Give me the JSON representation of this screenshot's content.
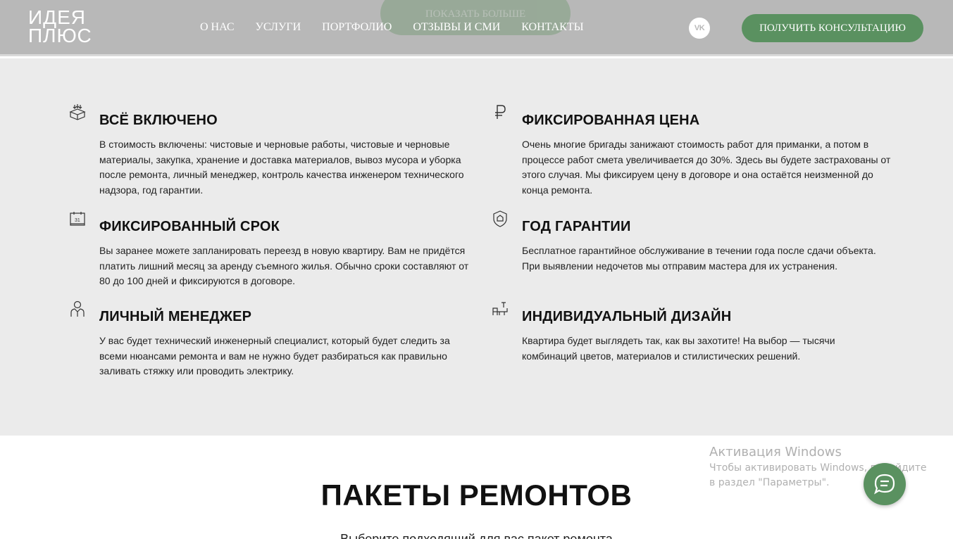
{
  "header": {
    "logo_line1": "ИДЕЯ",
    "logo_line2": "ПЛЮС",
    "ghost_button": "ПОКАЗАТЬ БОЛЬШЕ",
    "nav": [
      "О НАС",
      "УСЛУГИ",
      "ПОРТФОЛИО",
      "ОТЗЫВЫ И СМИ",
      "КОНТАКТЫ"
    ],
    "vk_label": "VK",
    "cta_label": "ПОЛУЧИТЬ КОНСУЛЬТАЦИЮ"
  },
  "features": [
    {
      "icon": "box-icon",
      "title": "ВСЁ ВКЛЮЧЕНО",
      "text": "В стоимость включены: чистовые и черновые работы, чистовые и черновые материалы, закупка, хранение и доставка материалов, вывоз мусора и уборка после ремонта, личный менеджер, контроль качества инженером технического надзора, год гарантии."
    },
    {
      "icon": "ruble-icon",
      "title": "ФИКСИРОВАННАЯ ЦЕНА",
      "text": "Очень многие бригады занижают стоимость работ для приманки, а потом в процессе работ смета увеличивается до 30%. Здесь вы будете застрахованы от этого случая. Мы фиксируем цену в договоре и она остаётся неизменной до конца ремонта."
    },
    {
      "icon": "calendar-icon",
      "icon_label": "31",
      "title": "ФИКСИРОВАННЫЙ СРОК",
      "text": "Вы заранее можете запланировать переезд в новую квартиру. Вам не придётся платить лишний месяц за аренду съемного жилья. Обычно сроки составляют от 80 до 100 дней и фиксируются в договоре."
    },
    {
      "icon": "shield-icon",
      "title": "ГОД ГАРАНТИИ",
      "text": "Бесплатное гарантийное обслуживание в течении года после сдачи объекта. При выявлении недочетов мы отправим мастера для их устранения."
    },
    {
      "icon": "manager-icon",
      "title": "ЛИЧНЫЙ МЕНЕДЖЕР",
      "text": "У вас будет технический инженерный специалист, который будет следить за всеми нюансами ремонта и вам не нужно будет разбираться как правильно заливать стяжку или проводить электрику."
    },
    {
      "icon": "furniture-icon",
      "title": "ИНДИВИДУАЛЬНЫЙ ДИЗАЙН",
      "text": "Квартира будет выглядеть так, как вы захотите! На выбор — тысячи комбинаций цветов, материалов и стилистических решений."
    }
  ],
  "packages": {
    "title": "ПАКЕТЫ РЕМОНТОВ",
    "subtitle": "Выберите подходящий для вас пакет ремонта"
  },
  "windows_notice": {
    "line1": "Активация Windows",
    "line2": "Чтобы активировать Windows, перейдите в раздел \"Параметры\"."
  },
  "colors": {
    "header_bg": "#b8b8b8",
    "accent_green": "#5a9160",
    "section_bg": "#ebebeb"
  }
}
